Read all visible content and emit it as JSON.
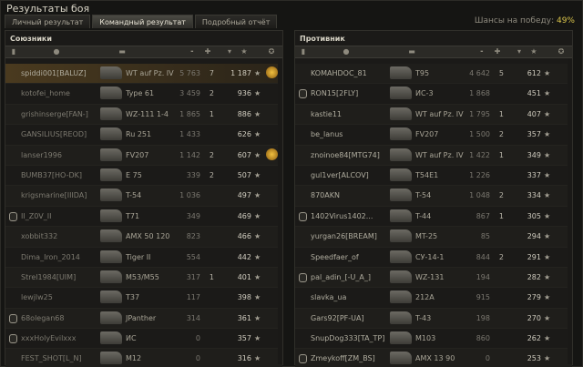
{
  "title": "Результаты боя",
  "tabs": [
    {
      "label": "Личный результат",
      "active": false
    },
    {
      "label": "Командный результат",
      "active": true
    },
    {
      "label": "Подробный отчёт",
      "active": false
    }
  ],
  "win_chance": {
    "label": "Шансы на победу:",
    "value": "49%"
  },
  "columns_icons": [
    "mic-header-icon",
    "player-header-icon",
    "tank-header-icon",
    "damage-header-icon",
    "frags-header-icon",
    "xp-header-icon",
    "star-header-icon",
    "medal-header-icon"
  ],
  "left": {
    "title": "Союзники",
    "rows": [
      {
        "mic": false,
        "name": "spiddi001[BALUZ]",
        "tank": "WT auf Pz. IV",
        "dmg": "5 763",
        "frags": "7",
        "xp": "1 187",
        "medal": true,
        "me": true,
        "alive": true
      },
      {
        "mic": false,
        "name": "kotofei_home",
        "tank": "Type 61",
        "dmg": "3 459",
        "frags": "2",
        "xp": "936",
        "medal": false,
        "me": false,
        "alive": false
      },
      {
        "mic": false,
        "name": "grishinserge[FAN-]",
        "tank": "WZ-111 1-4",
        "dmg": "1 865",
        "frags": "1",
        "xp": "886",
        "medal": false,
        "me": false,
        "alive": false
      },
      {
        "mic": false,
        "name": "GANSILIUS[REOD]",
        "tank": "Ru 251",
        "dmg": "1 433",
        "frags": "",
        "xp": "626",
        "medal": false,
        "me": false,
        "alive": false
      },
      {
        "mic": false,
        "name": "lanser1996",
        "tank": "FV207",
        "dmg": "1 142",
        "frags": "2",
        "xp": "607",
        "medal": true,
        "me": false,
        "alive": false
      },
      {
        "mic": false,
        "name": "BUMB37[HO-DK]",
        "tank": "E 75",
        "dmg": "339",
        "frags": "2",
        "xp": "507",
        "medal": false,
        "me": false,
        "alive": false
      },
      {
        "mic": false,
        "name": "krigsmarine[IIIDA]",
        "tank": "T-54",
        "dmg": "1 036",
        "frags": "",
        "xp": "497",
        "medal": false,
        "me": false,
        "alive": false
      },
      {
        "mic": true,
        "name": "II_Z0V_II",
        "tank": "T71",
        "dmg": "349",
        "frags": "",
        "xp": "469",
        "medal": false,
        "me": false,
        "alive": false
      },
      {
        "mic": false,
        "name": "xobbit332",
        "tank": "AMX 50 120",
        "dmg": "823",
        "frags": "",
        "xp": "466",
        "medal": false,
        "me": false,
        "alive": false
      },
      {
        "mic": false,
        "name": "Dima_Iron_2014",
        "tank": "Tiger II",
        "dmg": "554",
        "frags": "",
        "xp": "442",
        "medal": false,
        "me": false,
        "alive": false
      },
      {
        "mic": false,
        "name": "Strel1984[UIM]",
        "tank": "M53/M55",
        "dmg": "317",
        "frags": "1",
        "xp": "401",
        "medal": false,
        "me": false,
        "alive": false
      },
      {
        "mic": false,
        "name": "lewjlw25",
        "tank": "T37",
        "dmg": "117",
        "frags": "",
        "xp": "398",
        "medal": false,
        "me": false,
        "alive": false
      },
      {
        "mic": true,
        "name": "68olegan68",
        "tank": "JPanther",
        "dmg": "314",
        "frags": "",
        "xp": "361",
        "medal": false,
        "me": false,
        "alive": false
      },
      {
        "mic": true,
        "name": "xxxHolyEvilxxx",
        "tank": "ИС",
        "dmg": "0",
        "frags": "",
        "xp": "357",
        "medal": false,
        "me": false,
        "alive": false
      },
      {
        "mic": false,
        "name": "FEST_SHOT[L_N]",
        "tank": "M12",
        "dmg": "0",
        "frags": "",
        "xp": "316",
        "medal": false,
        "me": false,
        "alive": false
      }
    ]
  },
  "right": {
    "title": "Противник",
    "rows": [
      {
        "mic": false,
        "name": "KOMAHDOC_81",
        "tank": "T95",
        "dmg": "4 642",
        "frags": "5",
        "xp": "612",
        "medal": false,
        "me": false,
        "alive": true
      },
      {
        "mic": true,
        "name": "RON15[2FLY]",
        "tank": "ИС-3",
        "dmg": "1 868",
        "frags": "",
        "xp": "451",
        "medal": false,
        "me": false,
        "alive": true
      },
      {
        "mic": false,
        "name": "kastie11",
        "tank": "WT auf Pz. IV",
        "dmg": "1 795",
        "frags": "1",
        "xp": "407",
        "medal": false,
        "me": false,
        "alive": true
      },
      {
        "mic": false,
        "name": "be_lanus",
        "tank": "FV207",
        "dmg": "1 500",
        "frags": "2",
        "xp": "357",
        "medal": false,
        "me": false,
        "alive": true
      },
      {
        "mic": false,
        "name": "znoinoe84[MTG74]",
        "tank": "WT auf Pz. IV",
        "dmg": "1 422",
        "frags": "1",
        "xp": "349",
        "medal": false,
        "me": false,
        "alive": true
      },
      {
        "mic": false,
        "name": "gul1ver[ALCOV]",
        "tank": "T54E1",
        "dmg": "1 226",
        "frags": "",
        "xp": "337",
        "medal": false,
        "me": false,
        "alive": true
      },
      {
        "mic": false,
        "name": "870AKN",
        "tank": "T-54",
        "dmg": "1 048",
        "frags": "2",
        "xp": "334",
        "medal": false,
        "me": false,
        "alive": true
      },
      {
        "mic": true,
        "name": "1402Virus1402...",
        "tank": "T-44",
        "dmg": "867",
        "frags": "1",
        "xp": "305",
        "medal": false,
        "me": false,
        "alive": true
      },
      {
        "mic": false,
        "name": "yurgan26[BREAM]",
        "tank": "MT-25",
        "dmg": "85",
        "frags": "",
        "xp": "294",
        "medal": false,
        "me": false,
        "alive": true
      },
      {
        "mic": false,
        "name": "Speedfaer_of",
        "tank": "СУ-14-1",
        "dmg": "844",
        "frags": "2",
        "xp": "291",
        "medal": false,
        "me": false,
        "alive": true
      },
      {
        "mic": true,
        "name": "pal_adin_[-U_A_]",
        "tank": "WZ-131",
        "dmg": "194",
        "frags": "",
        "xp": "282",
        "medal": false,
        "me": false,
        "alive": true
      },
      {
        "mic": false,
        "name": "slavka_ua",
        "tank": "212A",
        "dmg": "915",
        "frags": "",
        "xp": "279",
        "medal": false,
        "me": false,
        "alive": true
      },
      {
        "mic": false,
        "name": "Gars92[PF-UA]",
        "tank": "T-43",
        "dmg": "198",
        "frags": "",
        "xp": "270",
        "medal": false,
        "me": false,
        "alive": true
      },
      {
        "mic": false,
        "name": "SnupDog333[TA_TP]",
        "tank": "M103",
        "dmg": "860",
        "frags": "",
        "xp": "262",
        "medal": false,
        "me": false,
        "alive": true
      },
      {
        "mic": true,
        "name": "Zmeykoff[ZM_BS]",
        "tank": "AMX 13 90",
        "dmg": "0",
        "frags": "",
        "xp": "253",
        "medal": false,
        "me": false,
        "alive": true
      }
    ]
  }
}
